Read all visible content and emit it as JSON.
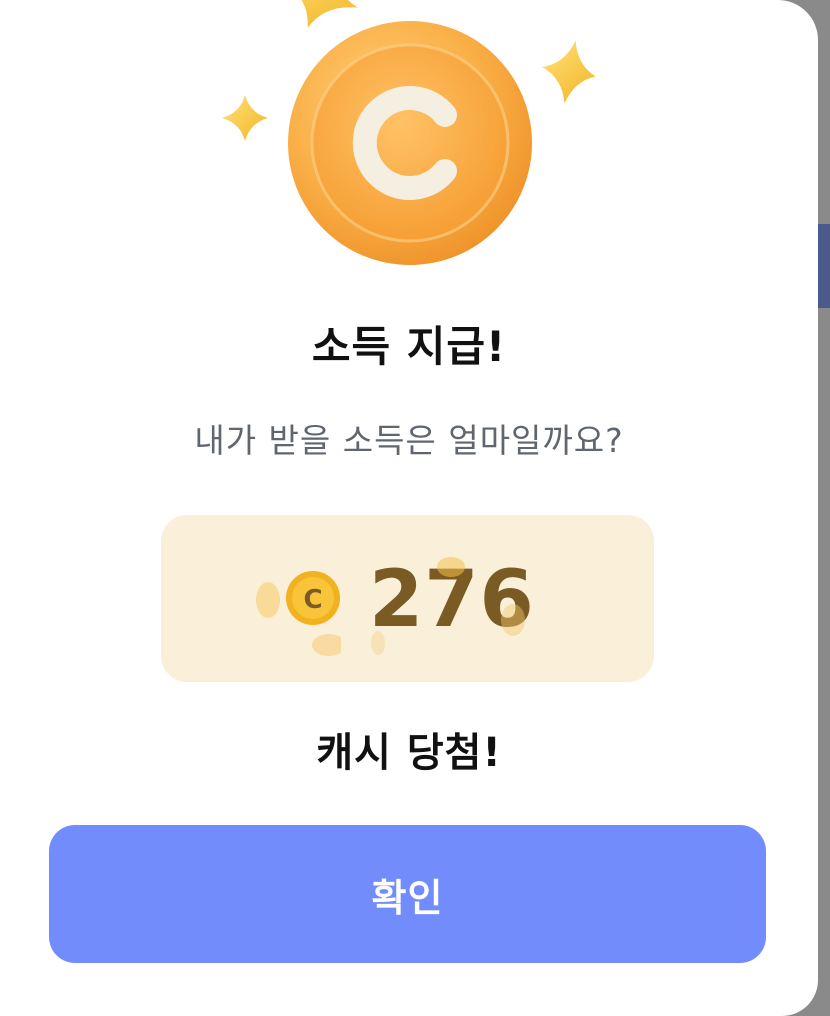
{
  "dialog": {
    "title": "소득 지급!",
    "subtitle": "내가 받을 소득은 얼마일까요?",
    "reward": {
      "coin_letter": "C",
      "amount": "276"
    },
    "result_text": "캐시 당첨!",
    "confirm_label": "확인"
  },
  "icons": {
    "hero": "coin-c-icon",
    "sparkles": "sparkle-star-icon",
    "reward": "small-coin-icon"
  },
  "colors": {
    "coin": "#f7a93b",
    "star": "#f6c233",
    "reward_box": "#faefd9",
    "amount_text": "#7a5b24",
    "button": "#738cfc",
    "button_text": "#ffffff"
  }
}
